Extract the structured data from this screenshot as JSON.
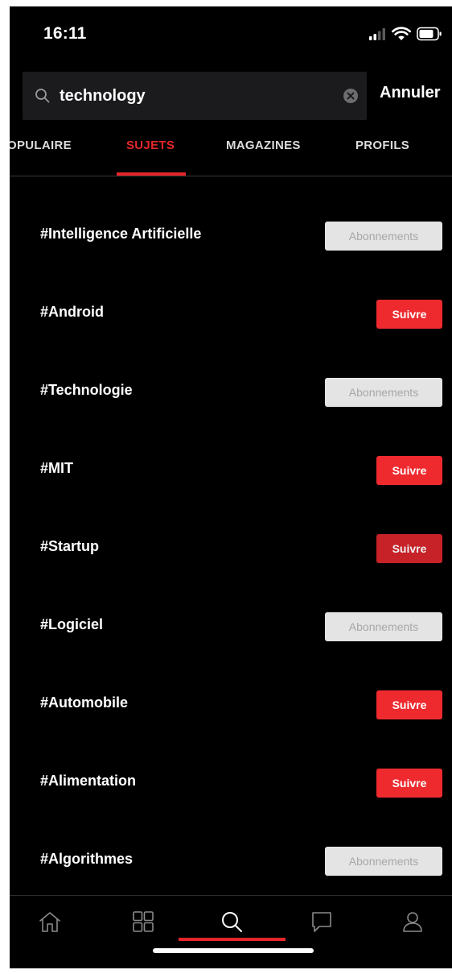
{
  "status_bar": {
    "time": "16:11",
    "icons": [
      "signal-icon",
      "wifi-icon",
      "battery-icon"
    ]
  },
  "search": {
    "value": "technology",
    "placeholder": "",
    "cancel_label": "Annuler"
  },
  "tabs": [
    {
      "label": "OPULAIRE",
      "active": false
    },
    {
      "label": "SUJETS",
      "active": true
    },
    {
      "label": "MAGAZINES",
      "active": false
    },
    {
      "label": "PROFILS",
      "active": false
    }
  ],
  "topics": [
    {
      "label": "#Intelligence Artificielle",
      "button": "Abonnements",
      "state": "subscribed"
    },
    {
      "label": "#Android",
      "button": "Suivre",
      "state": "follow"
    },
    {
      "label": "#Technologie",
      "button": "Abonnements",
      "state": "subscribed"
    },
    {
      "label": "#MIT",
      "button": "Suivre",
      "state": "follow"
    },
    {
      "label": "#Startup",
      "button": "Suivre",
      "state": "follow-pressed"
    },
    {
      "label": "#Logiciel",
      "button": "Abonnements",
      "state": "subscribed"
    },
    {
      "label": "#Automobile",
      "button": "Suivre",
      "state": "follow"
    },
    {
      "label": "#Alimentation",
      "button": "Suivre",
      "state": "follow"
    },
    {
      "label": "#Algorithmes",
      "button": "Abonnements",
      "state": "subscribed"
    }
  ],
  "bottom_nav": {
    "items": [
      "home-icon",
      "grid-icon",
      "search-icon",
      "chat-icon",
      "profile-icon"
    ],
    "active_index": 2
  },
  "colors": {
    "accent": "#e5262a",
    "follow_button": "#ee2a2f",
    "subscribed_button": "#e4e4e4",
    "background": "#000000"
  }
}
